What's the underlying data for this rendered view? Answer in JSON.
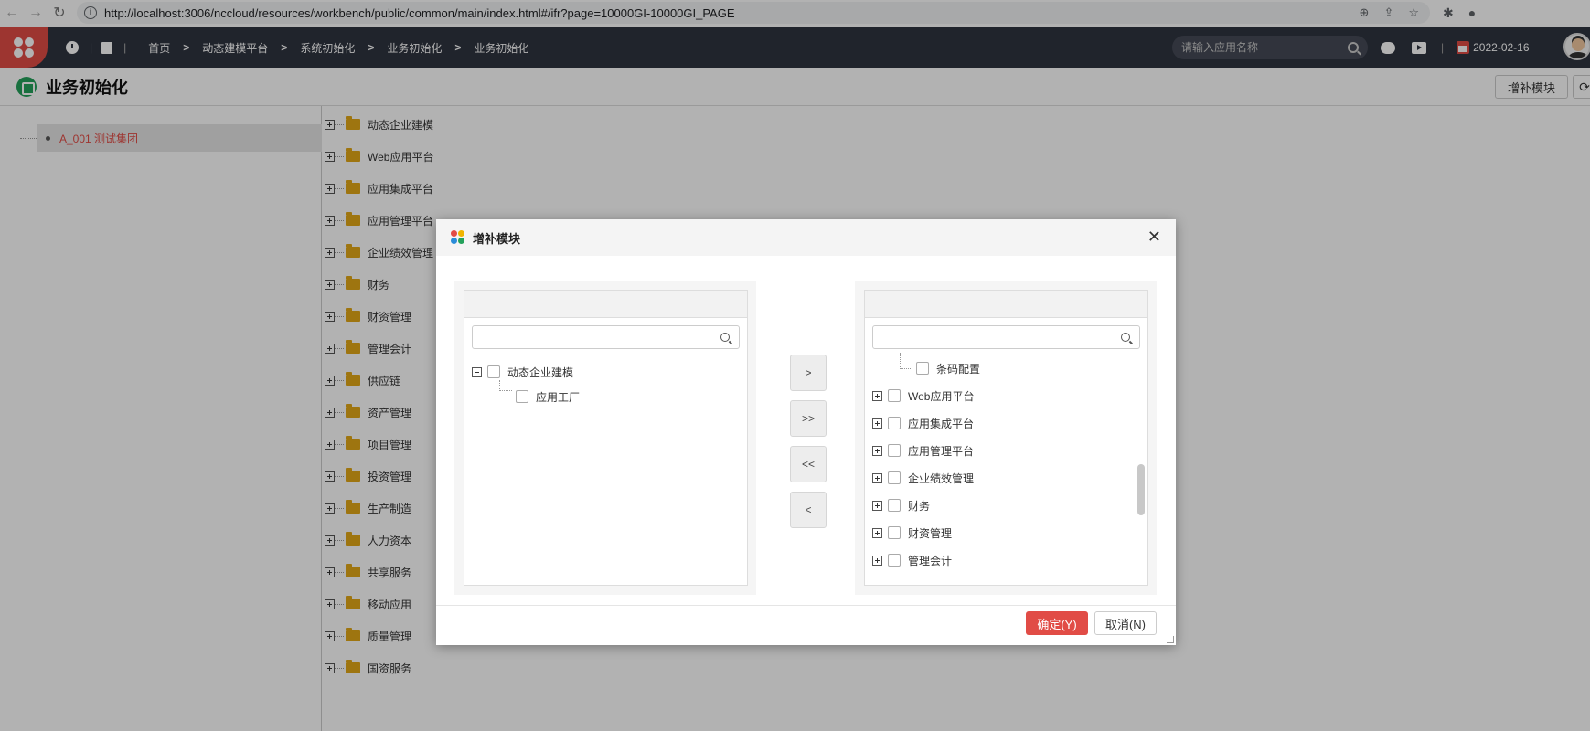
{
  "browser": {
    "url": "http://localhost:3006/nccloud/resources/workbench/public/common/main/index.html#/ifr?page=10000GI-10000GI_PAGE"
  },
  "header": {
    "breadcrumb": [
      "首页",
      "动态建模平台",
      "系统初始化",
      "业务初始化",
      "业务初始化"
    ],
    "search_placeholder": "请输入应用名称",
    "date": "2022-02-16",
    "accent": "#e14c46",
    "bg": "#2f3440"
  },
  "page": {
    "title": "业务初始化",
    "add_module_label": "增补模块",
    "refresh_glyph": "⟳"
  },
  "org_tree": {
    "root_label": "A_001 测试集团"
  },
  "modules": [
    "动态企业建模",
    "Web应用平台",
    "应用集成平台",
    "应用管理平台",
    "企业绩效管理",
    "财务",
    "财资管理",
    "管理会计",
    "供应链",
    "资产管理",
    "项目管理",
    "投资管理",
    "生产制造",
    "人力资本",
    "共享服务",
    "移动应用",
    "质量管理",
    "国资服务"
  ],
  "modal": {
    "title": "增补模块",
    "close_glyph": "✕",
    "left_tree": {
      "parent": "动态企业建模",
      "child": "应用工厂"
    },
    "right_tree": {
      "partial_child": "条码配置",
      "items": [
        "Web应用平台",
        "应用集成平台",
        "应用管理平台",
        "企业绩效管理",
        "财务",
        "财资管理",
        "管理会计"
      ]
    },
    "transfer_buttons": [
      ">",
      ">>",
      "<<",
      "<"
    ],
    "ok_label": "确定(Y)",
    "cancel_label": "取消(N)"
  }
}
